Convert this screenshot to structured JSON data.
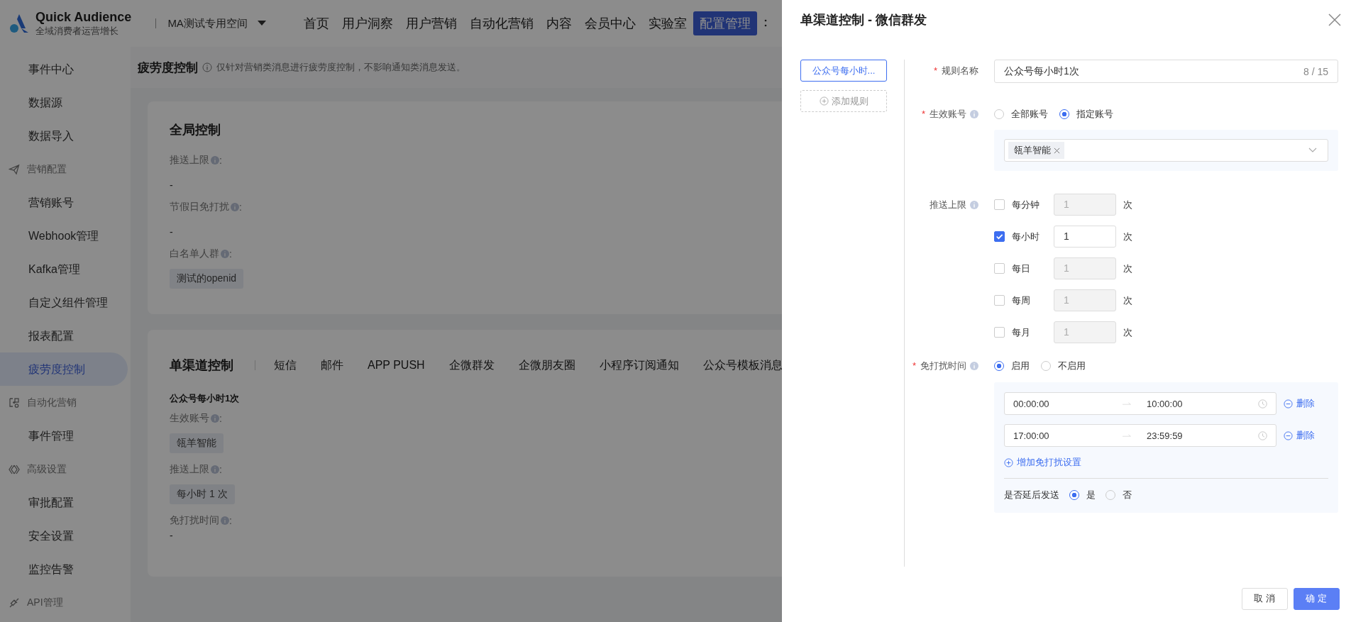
{
  "header": {
    "logo_title": "Quick Audience",
    "logo_subtitle": "全域消费者运营增长",
    "workspace": "MA测试专用空间",
    "nav": [
      {
        "label": "首页",
        "selected": false
      },
      {
        "label": "用户洞察",
        "selected": false
      },
      {
        "label": "用户营销",
        "selected": false
      },
      {
        "label": "自动化营销",
        "selected": false
      },
      {
        "label": "内容",
        "selected": false
      },
      {
        "label": "会员中心",
        "selected": false
      },
      {
        "label": "实验室",
        "selected": false
      },
      {
        "label": "配置管理",
        "selected": true
      }
    ]
  },
  "sidebar": {
    "items": [
      {
        "kind": "item",
        "label": "事件中心",
        "selected": false
      },
      {
        "kind": "item",
        "label": "数据源",
        "selected": false
      },
      {
        "kind": "item",
        "label": "数据导入",
        "selected": false
      },
      {
        "kind": "group",
        "label": "营销配置"
      },
      {
        "kind": "item",
        "label": "营销账号",
        "selected": false
      },
      {
        "kind": "item",
        "label": "Webhook管理",
        "selected": false
      },
      {
        "kind": "item",
        "label": "Kafka管理",
        "selected": false
      },
      {
        "kind": "item",
        "label": "自定义组件管理",
        "selected": false
      },
      {
        "kind": "item",
        "label": "报表配置",
        "selected": false
      },
      {
        "kind": "item",
        "label": "疲劳度控制",
        "selected": true
      },
      {
        "kind": "group",
        "label": "自动化营销"
      },
      {
        "kind": "item",
        "label": "事件管理",
        "selected": false
      },
      {
        "kind": "group",
        "label": "高级设置"
      },
      {
        "kind": "item",
        "label": "审批配置",
        "selected": false
      },
      {
        "kind": "item",
        "label": "安全设置",
        "selected": false
      },
      {
        "kind": "item",
        "label": "监控告警",
        "selected": false
      },
      {
        "kind": "group",
        "label": "API管理"
      }
    ]
  },
  "page_header": {
    "title": "疲劳度控制",
    "note": "仅针对营销类消息进行疲劳度控制，不影响通知类消息发送。"
  },
  "global_card": {
    "title": "全局控制",
    "fields": [
      {
        "label": "推送上限",
        "suffix": ":",
        "value": "-"
      },
      {
        "label": "节假日免打扰",
        "suffix": ":",
        "value": "-"
      },
      {
        "label": "白名单人群",
        "suffix": ":",
        "tags": [
          "测试的openid"
        ]
      }
    ]
  },
  "channel_card": {
    "title": "单渠道控制",
    "tabs": [
      "短信",
      "邮件",
      "APP PUSH",
      "企微群发",
      "企微朋友圈",
      "小程序订阅通知",
      "公众号模板消息"
    ],
    "rule": {
      "name": "公众号每小时1次",
      "fields": [
        {
          "label": "生效账号",
          "suffix": ":",
          "tags": [
            "瓴羊智能"
          ]
        },
        {
          "label": "推送上限",
          "suffix": ":",
          "tags": [
            "每小时 1 次"
          ]
        },
        {
          "label": "免打扰时间",
          "suffix": ":",
          "value": "-"
        }
      ]
    }
  },
  "drawer": {
    "title": "单渠道控制 - 微信群发",
    "rules": [
      {
        "label": "公众号每小时...",
        "selected": true
      }
    ],
    "add_rule": "添加规则",
    "name_field": {
      "mark": "*",
      "label": "规则名称",
      "value": "公众号每小时1次",
      "count": "8 / 15"
    },
    "account_field": {
      "mark": "*",
      "label": "生效账号",
      "options": [
        {
          "label": "全部账号",
          "selected": false
        },
        {
          "label": "指定账号",
          "selected": true
        }
      ],
      "tags": [
        "瓴羊智能"
      ]
    },
    "limit_field": {
      "label": "推送上限",
      "rows": [
        {
          "label": "每分钟",
          "checked": false,
          "value": "1",
          "unit": "次"
        },
        {
          "label": "每小时",
          "checked": true,
          "value": "1",
          "unit": "次"
        },
        {
          "label": "每日",
          "checked": false,
          "value": "1",
          "unit": "次"
        },
        {
          "label": "每周",
          "checked": false,
          "value": "1",
          "unit": "次"
        },
        {
          "label": "每月",
          "checked": false,
          "value": "1",
          "unit": "次"
        }
      ]
    },
    "dnd_field": {
      "mark": "*",
      "label": "免打扰时间",
      "options": [
        {
          "label": "启用",
          "selected": true
        },
        {
          "label": "不启用",
          "selected": false
        }
      ],
      "ranges": [
        {
          "start": "00:00:00",
          "end": "10:00:00",
          "delete": "删除"
        },
        {
          "start": "17:00:00",
          "end": "23:59:59",
          "delete": "删除"
        }
      ],
      "add": "增加免打扰设置",
      "delay": {
        "label": "是否延后发送",
        "options": [
          {
            "label": "是",
            "selected": true
          },
          {
            "label": "否",
            "selected": false
          }
        ]
      }
    },
    "buttons": [
      {
        "label": "取消",
        "kind": "default"
      },
      {
        "label": "确定",
        "kind": "primary"
      }
    ]
  }
}
